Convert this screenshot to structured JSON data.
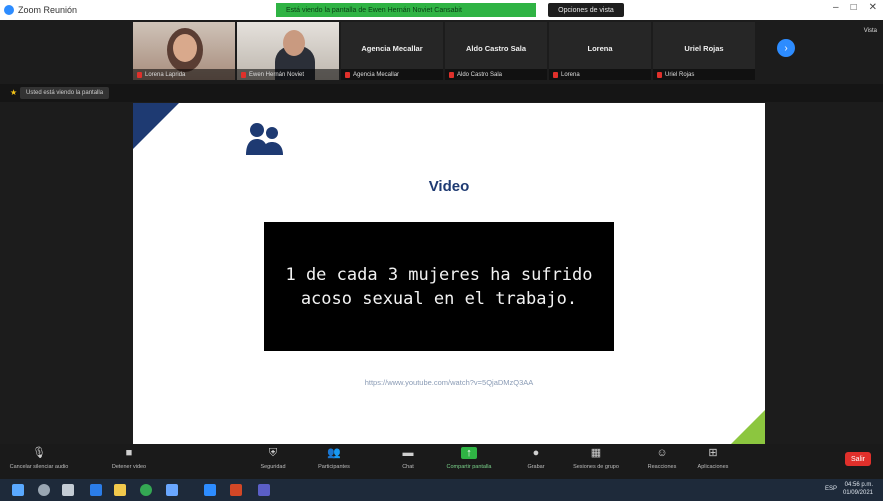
{
  "window": {
    "title": "Zoom Reunión",
    "controls": [
      "–",
      "□",
      "✕"
    ]
  },
  "share_banner": {
    "text": "Está viendo la pantalla de Ewen Hernán Noviet Cansabit",
    "stop_button": "Opciones de vista"
  },
  "participants": [
    {
      "name": "Lorena Laprida",
      "has_video": true
    },
    {
      "name": "Ewen Hernán Noviet",
      "has_video": true
    },
    {
      "name": "Agencia Mecallar",
      "has_video": false
    },
    {
      "name": "Aldo Castro Sala",
      "has_video": false
    },
    {
      "name": "Lorena",
      "has_video": false
    },
    {
      "name": "Uriel Rojas",
      "has_video": false
    }
  ],
  "strip": {
    "next_icon": "chevron-right-icon",
    "view_label": "Vista"
  },
  "presenter": {
    "label": "Usted está viendo la pantalla"
  },
  "slide": {
    "title": "Video",
    "video_text": "1 de cada 3 mujeres ha sufrido\nacoso sexual en el trabajo.",
    "link": "https://www.youtube.com/watch?v=5QjaDMzQ3AA",
    "colors": {
      "navy": "#1e3a72",
      "green": "#8cc63f"
    }
  },
  "toolbar": {
    "buttons": [
      {
        "label": "Cancelar silenciar audio",
        "icon": "microphone-icon"
      },
      {
        "label": "Detener video",
        "icon": "video-camera-icon"
      },
      {
        "label": "Seguridad",
        "icon": "shield-icon"
      },
      {
        "label": "Participantes",
        "icon": "participants-icon"
      },
      {
        "label": "Chat",
        "icon": "chat-icon"
      },
      {
        "label": "Compartir pantalla",
        "icon": "share-screen-icon"
      },
      {
        "label": "Grabar",
        "icon": "record-icon"
      },
      {
        "label": "Sesiones de grupo",
        "icon": "breakout-rooms-icon"
      },
      {
        "label": "Reacciones",
        "icon": "reactions-icon"
      },
      {
        "label": "Aplicaciones",
        "icon": "apps-icon"
      }
    ],
    "end_label": "Salir"
  },
  "taskbar": {
    "icons": [
      "windows-start-icon",
      "search-icon",
      "task-view-icon",
      "edge-icon",
      "file-explorer-icon",
      "chrome-icon",
      "store-icon",
      "zoom-icon",
      "powerpoint-icon",
      "teams-icon"
    ],
    "tray": {
      "language": "ESP",
      "time": "04:56 p.m.",
      "date": "01/09/2021"
    }
  }
}
